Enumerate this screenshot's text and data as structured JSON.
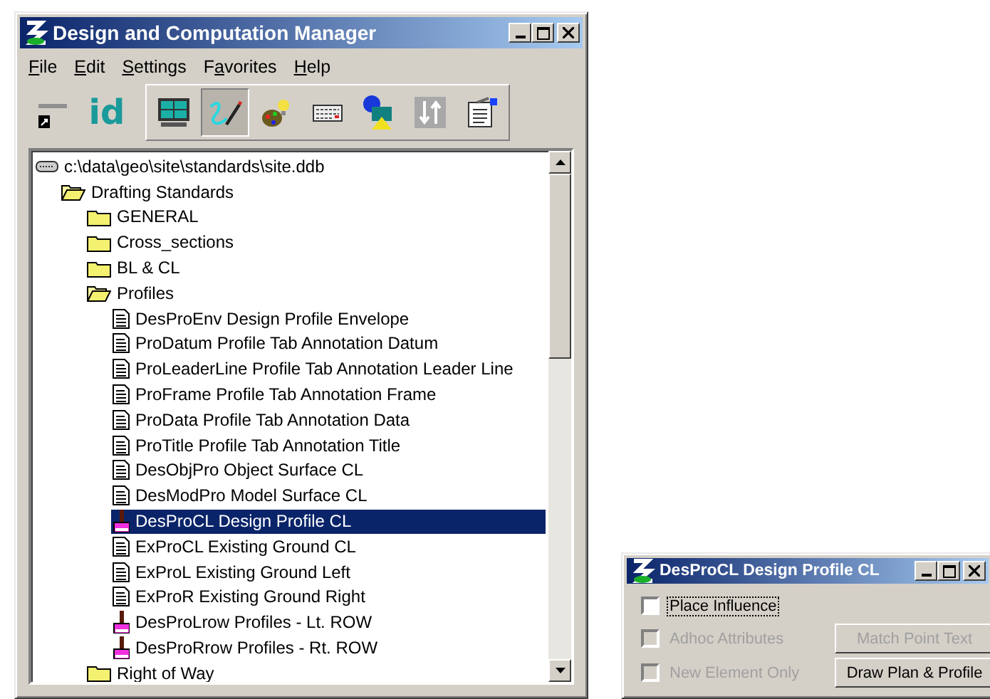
{
  "main_window": {
    "title": "Design and Computation Manager",
    "menu": [
      {
        "key": "F",
        "post": "ile"
      },
      {
        "key": "E",
        "post": "dit"
      },
      {
        "key": "S",
        "post": "ettings"
      },
      {
        "pre": "F",
        "key": "a",
        "post": "vorites"
      },
      {
        "key": "H",
        "post": "elp"
      }
    ],
    "toolbar_loose": [
      {
        "kind": "shortcut",
        "selected": false
      },
      {
        "kind": "id",
        "label": "id",
        "selected": false
      }
    ],
    "toolbar_group": [
      {
        "kind": "monitor",
        "selected": false
      },
      {
        "kind": "pencil",
        "selected": true
      },
      {
        "kind": "palette",
        "selected": false
      },
      {
        "kind": "keyboard",
        "selected": false
      },
      {
        "kind": "shapes",
        "selected": false
      },
      {
        "kind": "arrows",
        "selected": false
      },
      {
        "kind": "clipboard",
        "selected": false
      }
    ],
    "tree": [
      {
        "kind": "database",
        "label": "c:\\data\\geo\\site\\standards\\site.ddb",
        "selected": false,
        "children": [
          {
            "kind": "folder",
            "label": "Drafting Standards",
            "expanded": true,
            "selected": false,
            "children": [
              {
                "kind": "folder",
                "label": "GENERAL",
                "expanded": false,
                "selected": false
              },
              {
                "kind": "folder",
                "label": "Cross_sections",
                "expanded": false,
                "selected": false
              },
              {
                "kind": "folder",
                "label": "BL & CL",
                "expanded": false,
                "selected": false
              },
              {
                "kind": "folder",
                "label": "Profiles",
                "expanded": true,
                "selected": false,
                "children": [
                  {
                    "kind": "file",
                    "label": "DesProEnv Design Profile Envelope",
                    "selected": false
                  },
                  {
                    "kind": "file",
                    "label": "ProDatum Profile Tab Annotation Datum",
                    "selected": false
                  },
                  {
                    "kind": "file",
                    "label": "ProLeaderLine Profile Tab Annotation Leader Line",
                    "selected": false
                  },
                  {
                    "kind": "file",
                    "label": "ProFrame Profile Tab Annotation Frame",
                    "selected": false
                  },
                  {
                    "kind": "file",
                    "label": "ProData Profile Tab Annotation Data",
                    "selected": false
                  },
                  {
                    "kind": "file",
                    "label": "ProTitle Profile Tab Annotation Title",
                    "selected": false
                  },
                  {
                    "kind": "file",
                    "label": "DesObjPro Object Surface CL",
                    "selected": false
                  },
                  {
                    "kind": "file",
                    "label": "DesModPro Model Surface CL",
                    "selected": false
                  },
                  {
                    "kind": "style",
                    "label": "DesProCL Design Profile CL",
                    "selected": true
                  },
                  {
                    "kind": "file",
                    "label": "ExProCL Existing Ground CL",
                    "selected": false
                  },
                  {
                    "kind": "file",
                    "label": "ExProL Existing Ground Left",
                    "selected": false
                  },
                  {
                    "kind": "file",
                    "label": "ExProR Existing Ground Right",
                    "selected": false
                  },
                  {
                    "kind": "style",
                    "label": "DesProLrow Profiles - Lt. ROW",
                    "selected": false
                  },
                  {
                    "kind": "style",
                    "label": "DesProRrow Profiles - Rt. ROW",
                    "selected": false
                  }
                ]
              },
              {
                "kind": "folder",
                "label": "Right of Way",
                "expanded": false,
                "selected": false
              }
            ]
          }
        ]
      }
    ]
  },
  "dialog": {
    "title": "DesProCL Design Profile CL",
    "checkboxes": [
      {
        "label": "Place Influence",
        "checked": false,
        "disabled": false,
        "focused": true
      },
      {
        "label": "Adhoc Attributes",
        "checked": false,
        "disabled": true,
        "focused": false
      },
      {
        "label": "New Element Only",
        "checked": false,
        "disabled": true,
        "focused": false
      }
    ],
    "buttons": [
      {
        "label": "Match Point Text",
        "disabled": true
      },
      {
        "label": "Draw Plan & Profile",
        "disabled": false
      }
    ]
  }
}
